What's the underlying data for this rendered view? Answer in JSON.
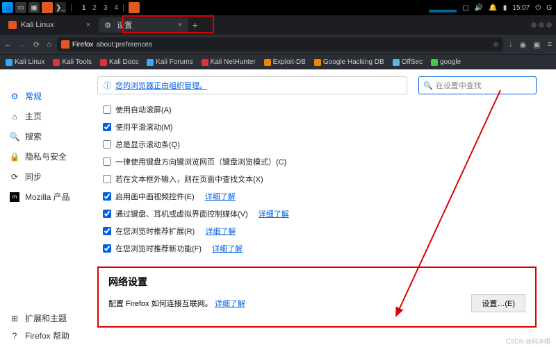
{
  "taskbar": {
    "workspaces": [
      "1",
      "2",
      "3",
      "4"
    ],
    "active_ws": "1",
    "time": "15:07"
  },
  "tabs": [
    {
      "label": "Kali Linux",
      "favicon": "kali"
    },
    {
      "label": "设置",
      "favicon": "gear"
    }
  ],
  "url": {
    "prefix": "Firefox",
    "path": "about:preferences"
  },
  "bookmarks": [
    {
      "label": "Kali Linux",
      "color": "#3af"
    },
    {
      "label": "Kali Tools",
      "color": "#d33"
    },
    {
      "label": "Kali Docs",
      "color": "#d33"
    },
    {
      "label": "Kali Forums",
      "color": "#3af"
    },
    {
      "label": "Kali NetHunter",
      "color": "#d33"
    },
    {
      "label": "Exploit-DB",
      "color": "#e80"
    },
    {
      "label": "Google Hacking DB",
      "color": "#e80"
    },
    {
      "label": "OffSec",
      "color": "#5bd"
    },
    {
      "label": "google",
      "color": "#4c4"
    }
  ],
  "sidebar": {
    "items": [
      {
        "label": "常规",
        "icon": "gear",
        "active": true
      },
      {
        "label": "主页",
        "icon": "home"
      },
      {
        "label": "搜索",
        "icon": "search"
      },
      {
        "label": "隐私与安全",
        "icon": "lock"
      },
      {
        "label": "同步",
        "icon": "sync"
      },
      {
        "label": "Mozilla 产品",
        "icon": "mozilla"
      }
    ],
    "bottom": [
      {
        "label": "扩展和主题",
        "icon": "puzzle"
      },
      {
        "label": "Firefox 帮助",
        "icon": "help"
      }
    ]
  },
  "banner": {
    "text": "您的浏览器正由组织管理。"
  },
  "search": {
    "placeholder": "在设置中查找"
  },
  "checks": [
    {
      "label": "使用自动滚屏(A)",
      "checked": false
    },
    {
      "label": "使用平滑滚动(M)",
      "checked": true
    },
    {
      "label": "总是显示滚动条(Q)",
      "checked": false
    },
    {
      "label": "一律使用键盘方向键浏览网页（键盘浏览模式）(C)",
      "checked": false
    },
    {
      "label": "若在文本框外输入，则在页面中查找文本(X)",
      "checked": false
    },
    {
      "label": "启用画中画视频控件(E)",
      "checked": true,
      "link": "详细了解"
    },
    {
      "label": "通过键盘、耳机或虚拟界面控制媒体(V)",
      "checked": true,
      "link": "详细了解"
    },
    {
      "label": "在您浏览时推荐扩展(R)",
      "checked": true,
      "link": "详细了解"
    },
    {
      "label": "在您浏览时推荐新功能(F)",
      "checked": true,
      "link": "详细了解"
    }
  ],
  "network": {
    "title": "网络设置",
    "desc": "配置 Firefox 如何连接互联网。",
    "link": "详细了解",
    "button": "设置…(E)"
  },
  "watermark": "CSDN @码冰眼"
}
